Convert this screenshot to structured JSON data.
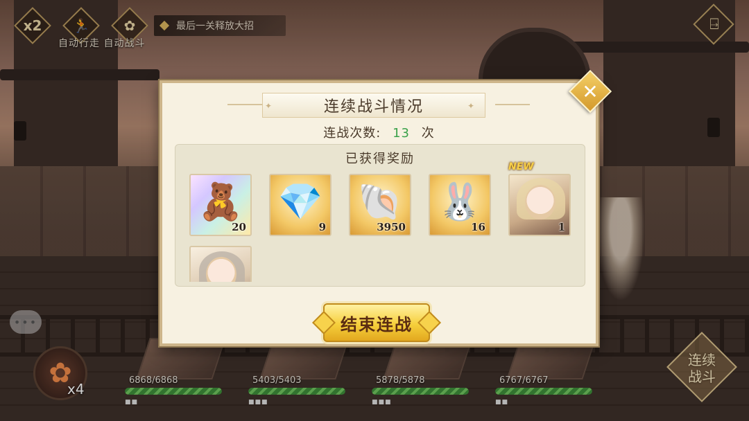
{
  "hud": {
    "speed_label": "x2",
    "walk_icon": "running-figure-icon",
    "auto_icon": "flower-icon",
    "auto_labels": "自动行走 自动战斗",
    "hint_text": "最后一关释放大招",
    "exit_icon": "exit-door-icon"
  },
  "modal": {
    "title": "连续战斗情况",
    "count_label": "连战次数:",
    "count_value": "13",
    "count_unit": "次",
    "rewards_title": "已获得奖励",
    "rewards": [
      {
        "icon": "golden-bear-icon",
        "quantity": "20"
      },
      {
        "icon": "blue-crystal-icon",
        "quantity": "9"
      },
      {
        "icon": "seashell-icon",
        "quantity": "3950"
      },
      {
        "icon": "white-rabbit-cake-icon",
        "quantity": "16"
      },
      {
        "icon": "character-portrait-blonde",
        "quantity": "1",
        "badge": "NEW"
      },
      {
        "icon": "character-portrait-gray-hair",
        "quantity": ""
      }
    ],
    "end_button": "结束连战",
    "close_icon": "close-x-icon"
  },
  "bottom": {
    "skill_multiplier": "x4",
    "heroes": [
      {
        "hp": "6868/6868",
        "hp_fraction": 1.0
      },
      {
        "hp": "5403/5403",
        "hp_fraction": 1.0
      },
      {
        "hp": "5878/5878",
        "hp_fraction": 1.0
      },
      {
        "hp": "6767/6767",
        "hp_fraction": 1.0
      }
    ],
    "battle_line1": "连续",
    "battle_line2": "战斗"
  },
  "colors": {
    "count_green": "#3aa14a",
    "button_gold": "#f6cf3b",
    "panel_cream": "#f7f1e1"
  }
}
